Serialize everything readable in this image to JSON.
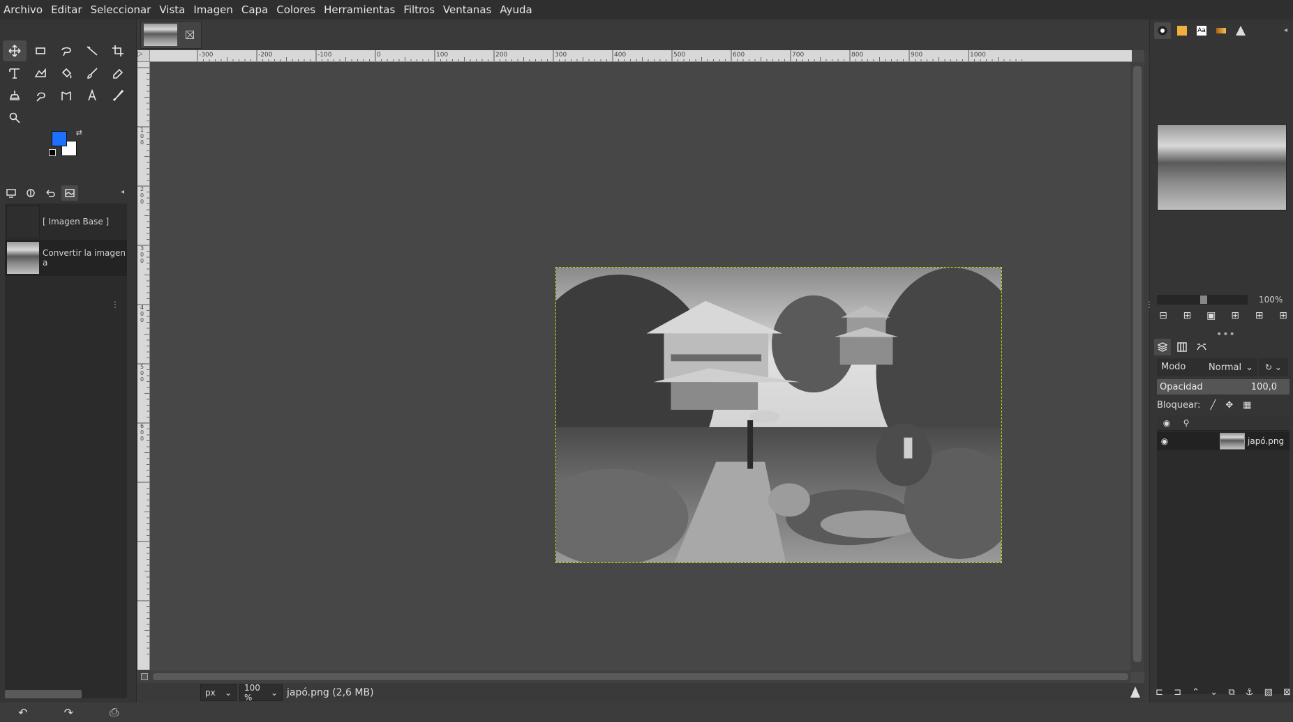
{
  "menu": [
    "Archivo",
    "Editar",
    "Seleccionar",
    "Vista",
    "Imagen",
    "Capa",
    "Colores",
    "Herramientas",
    "Filtros",
    "Ventanas",
    "Ayuda"
  ],
  "tools": [
    "move-tool",
    "rect-select-tool",
    "free-select-tool",
    "fuzzy-select-tool",
    "crop-tool",
    "unified-transform-tool",
    "warp-transform-tool",
    "bucket-fill-tool",
    "paintbrush-tool",
    "eraser-tool",
    "clone-tool",
    "smudge-tool",
    "cage-transform-tool",
    "text-tool",
    "color-picker-tool",
    "zoom-tool"
  ],
  "colors": {
    "foreground": "#1f6fff",
    "background": "#ffffff"
  },
  "undo_history": [
    {
      "label": "[ Imagen Base ]"
    },
    {
      "label": "Convertir la imagen a"
    }
  ],
  "ruler_ticks": [
    "-300",
    "-200",
    "-100",
    "0",
    "100",
    "200",
    "300",
    "400",
    "500",
    "600",
    "700",
    "800",
    "900",
    "1000"
  ],
  "vruler_ticks": [
    "1",
    "0",
    "0",
    "2",
    "0",
    "0",
    "3",
    "0",
    "0",
    "4",
    "0",
    "0",
    "5",
    "0",
    "0",
    "6",
    "0",
    "0"
  ],
  "status": {
    "unit": "px",
    "zoom": "100 %",
    "text": "japó.png (2,6 MB)"
  },
  "navigator": {
    "zoom": "100%"
  },
  "layers_panel": {
    "mode_label": "Modo",
    "mode_value": "Normal",
    "opacity_label": "Opacidad",
    "opacity_value": "100,0",
    "lock_label": "Bloquear:",
    "layers": [
      {
        "name": "japó.png",
        "visible": true
      }
    ]
  }
}
